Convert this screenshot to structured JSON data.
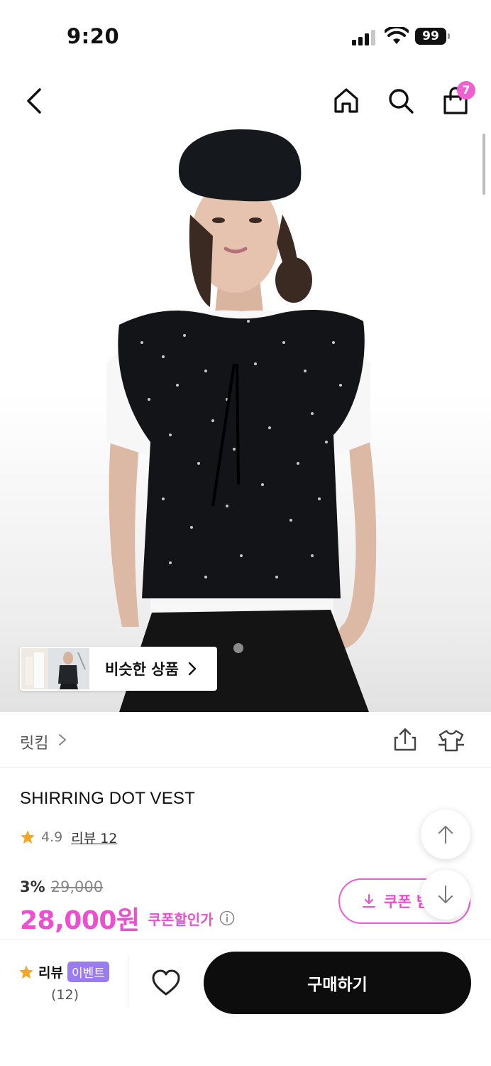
{
  "status_bar": {
    "time": "9:20",
    "battery": "99"
  },
  "nav": {
    "cart_count": "7"
  },
  "hero": {
    "similar_label": "비슷한 상품"
  },
  "brand": {
    "name": "릿킴"
  },
  "product": {
    "name": "SHIRRING DOT VEST",
    "rating": "4.9",
    "review_link": "리뷰 12",
    "discount_pct": "3%",
    "original_price": "29,000",
    "price": "28,000원",
    "coupon_price_label": "쿠폰할인가",
    "coupon_button": "쿠폰 받"
  },
  "bottom_bar": {
    "review_label": "리뷰",
    "event_badge": "이벤트",
    "review_count": "(12)",
    "buy_label": "구매하기"
  },
  "colors": {
    "accent": "#ec4fd0",
    "event": "#9b7cf0",
    "star": "#f5a623"
  }
}
